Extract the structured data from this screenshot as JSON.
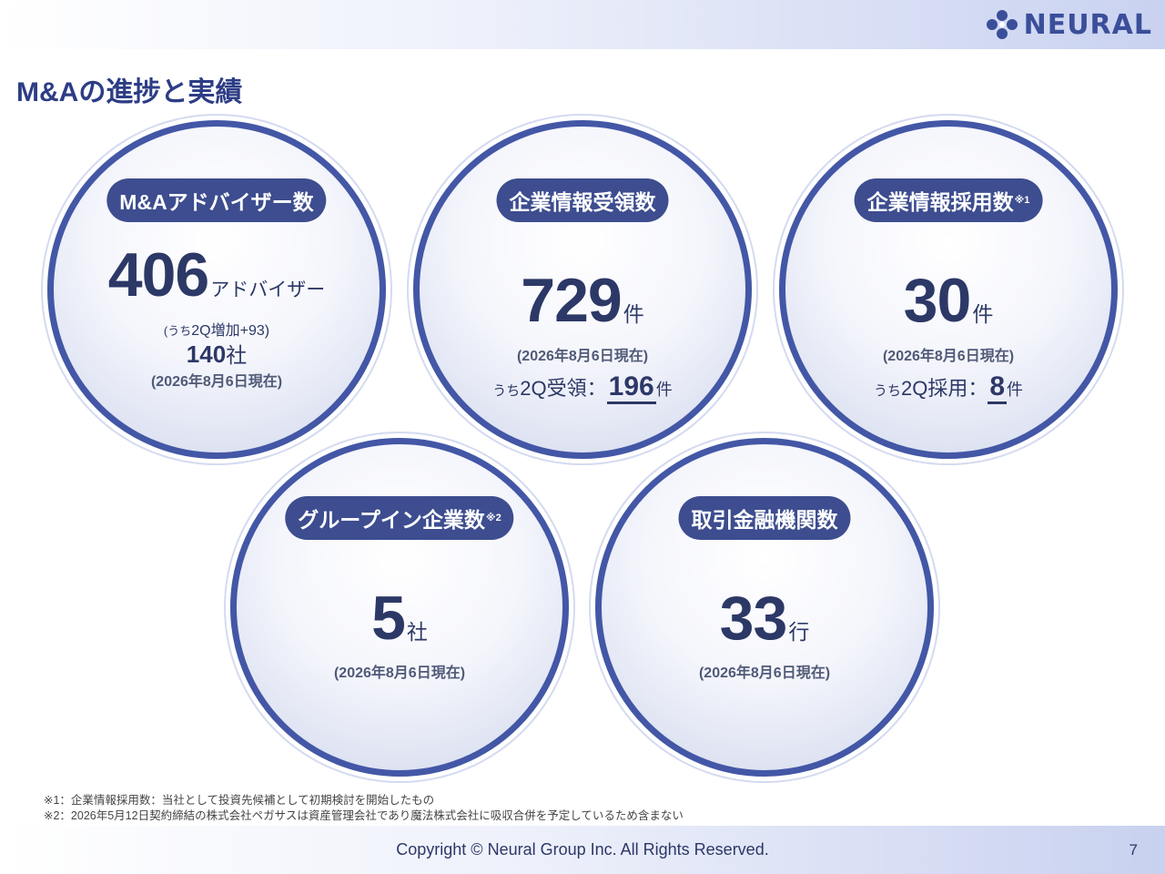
{
  "header": {
    "logo_text": "NEURAL",
    "logo_icon": "molecule-dots-icon",
    "brand_color": "#3b4e9a"
  },
  "page_title": "M&Aの進捗と実績",
  "colors": {
    "ring": "#4357a6",
    "pill": "#3d4d8f",
    "text": "#2c3866"
  },
  "circles": {
    "advisors": {
      "label": "M&Aアドバイザー数",
      "value": "406",
      "unit": "アドバイザー",
      "q2_note_prefix": "(うち",
      "q2_note": "2Q増加+93)",
      "companies_value": "140",
      "companies_unit": "社",
      "as_of": "(2026年8月6日現在)"
    },
    "info_received": {
      "label": "企業情報受領数",
      "value": "729",
      "unit": "件",
      "as_of": "(2026年8月6日現在)",
      "q2_prefix": "うち",
      "q2_label": "2Q受領：",
      "q2_value": "196",
      "q2_unit": "件"
    },
    "info_adopted": {
      "label": "企業情報採用数",
      "label_mark": "※1",
      "value": "30",
      "unit": "件",
      "as_of": "(2026年8月6日現在)",
      "q2_prefix": "うち",
      "q2_label": "2Q採用：",
      "q2_value": "8",
      "q2_unit": "件"
    },
    "group_in": {
      "label": "グループイン企業数",
      "label_mark": "※2",
      "value": "5",
      "unit": "社",
      "as_of": "(2026年8月6日現在)"
    },
    "banks": {
      "label": "取引金融機関数",
      "value": "33",
      "unit": "行",
      "as_of": "(2026年8月6日現在)"
    }
  },
  "footnotes": [
    "※1：企業情報採用数：当社として投資先候補として初期検討を開始したもの",
    "※2：2026年5月12日契約締結の株式会社ペガサスは資産管理会社であり魔法株式会社に吸収合併を予定しているため含まない"
  ],
  "footer": {
    "copyright": "Copyright © Neural Group Inc. All Rights Reserved.",
    "page_number": "7"
  }
}
